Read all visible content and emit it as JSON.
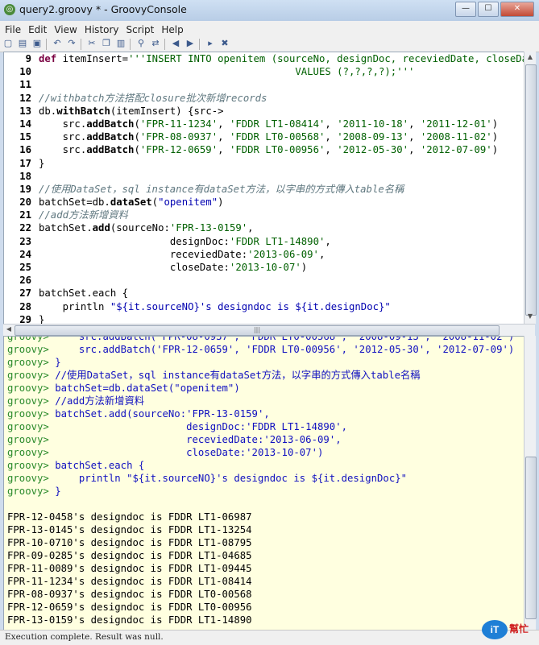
{
  "window": {
    "title": "query2.groovy * - GroovyConsole",
    "app_icon": "groovy-icon",
    "minimize": "—",
    "maximize": "☐",
    "close": "✕"
  },
  "menu": [
    "File",
    "Edit",
    "View",
    "History",
    "Script",
    "Help"
  ],
  "toolbar_icons": [
    "new-file-icon",
    "open-icon",
    "save-icon",
    "undo-icon",
    "redo-icon",
    "cut-icon",
    "copy-icon",
    "paste-icon",
    "find-icon",
    "replace-icon",
    "history-prev-icon",
    "history-next-icon",
    "run-icon",
    "clear-icon"
  ],
  "editor": {
    "line_numbers": [
      "9",
      "10",
      "11",
      "12",
      "13",
      "14",
      "15",
      "16",
      "17",
      "18",
      "19",
      "20",
      "21",
      "22",
      "23",
      "24",
      "25",
      "26",
      "27",
      "28",
      "29"
    ]
  },
  "output": {
    "prompt": "groovy>"
  },
  "results": [
    "FPR-12-0458's designdoc is FDDR LT1-06987",
    "FPR-13-0145's designdoc is FDDR LT1-13254",
    "FPR-10-0710's designdoc is FDDR LT1-08795",
    "FPR-09-0285's designdoc is FDDR LT1-04685",
    "FPR-11-0089's designdoc is FDDR LT1-09445",
    "FPR-11-1234's designdoc is FDDR LT1-08414",
    "FPR-08-0937's designdoc is FDDR LT0-00568",
    "FPR-12-0659's designdoc is FDDR LT0-00956",
    "FPR-13-0159's designdoc is FDDR LT1-14890"
  ],
  "status": "Execution complete. Result was null.",
  "watermark": {
    "bubble": "iT",
    "word": "幫忙"
  }
}
